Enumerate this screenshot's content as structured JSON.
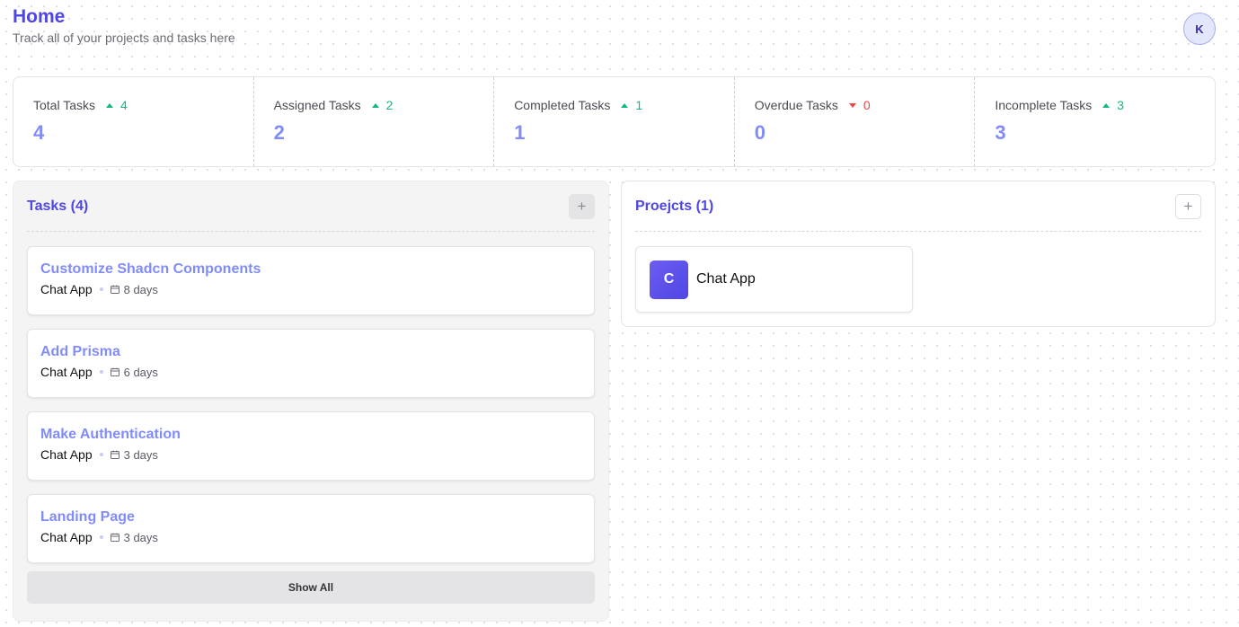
{
  "header": {
    "title": "Home",
    "subtitle": "Track all of your projects and tasks here",
    "avatar_initial": "K"
  },
  "stats": [
    {
      "label": "Total Tasks",
      "trend": "4",
      "direction": "up",
      "value": "4"
    },
    {
      "label": "Assigned Tasks",
      "trend": "2",
      "direction": "up",
      "value": "2"
    },
    {
      "label": "Completed Tasks",
      "trend": "1",
      "direction": "up",
      "value": "1"
    },
    {
      "label": "Overdue Tasks",
      "trend": "0",
      "direction": "down",
      "value": "0"
    },
    {
      "label": "Incomplete Tasks",
      "trend": "3",
      "direction": "up",
      "value": "3"
    }
  ],
  "tasks": {
    "title": "Tasks (4)",
    "add_label": "+",
    "items": [
      {
        "name": "Customize Shadcn Components",
        "project": "Chat App",
        "due": "8 days"
      },
      {
        "name": "Add Prisma",
        "project": "Chat App",
        "due": "6 days"
      },
      {
        "name": "Make Authentication",
        "project": "Chat App",
        "due": "3 days"
      },
      {
        "name": "Landing Page",
        "project": "Chat App",
        "due": "3 days"
      }
    ],
    "show_all_label": "Show All"
  },
  "projects": {
    "title": "Proejcts (1)",
    "add_label": "+",
    "items": [
      {
        "initial": "C",
        "name": "Chat App"
      }
    ]
  },
  "colors": {
    "accent": "#4f46e5",
    "accent_light": "#818cf8",
    "trend_up": "#10b981",
    "trend_down": "#ef4444"
  }
}
